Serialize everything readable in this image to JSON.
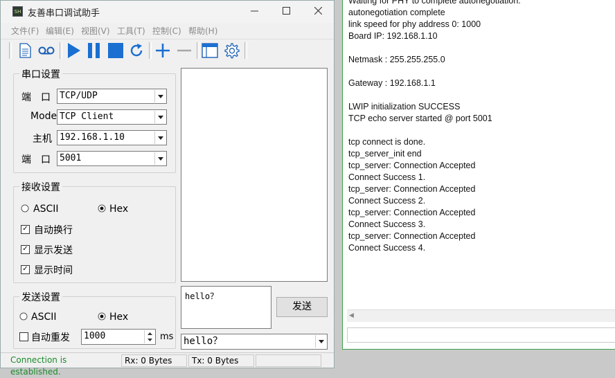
{
  "window": {
    "title": "友善串口调试助手",
    "app_icon_text": "SH",
    "minimize_icon": "minimize-icon",
    "maximize_icon": "maximize-icon",
    "close_icon": "close-icon"
  },
  "menu": [
    "文件(F)",
    "编辑(E)",
    "视图(V)",
    "工具(T)",
    "控制(C)",
    "帮助(H)"
  ],
  "toolbar": {
    "icons": [
      "document-icon",
      "cassette-icon",
      "play-icon",
      "pause-icon",
      "stop-icon",
      "refresh-icon",
      "plus-icon",
      "minus-icon",
      "window-icon",
      "gear-icon"
    ],
    "accent_color": "#1a6fd1"
  },
  "serial": {
    "title": "串口设置",
    "port_label": "端　口",
    "port_value": "TCP/UDP",
    "mode_label": "Mode",
    "mode_value": "TCP Client",
    "host_label": "主机",
    "host_value": "192.168.1.10",
    "port2_label": "端　口",
    "port2_value": "5001"
  },
  "receive": {
    "title": "接收设置",
    "ascii": "ASCII",
    "hex": "Hex",
    "selected": "Hex",
    "auto_newline": "自动换行",
    "show_send": "显示发送",
    "show_time": "显示时间",
    "auto_newline_checked": true,
    "show_send_checked": true,
    "show_time_checked": true
  },
  "send": {
    "title": "发送设置",
    "ascii": "ASCII",
    "hex": "Hex",
    "selected": "Hex",
    "auto_repeat": "自动重发",
    "auto_repeat_checked": false,
    "interval": "1000",
    "unit": "ms",
    "text": "hello？",
    "button": "发送",
    "history_value": "hello？"
  },
  "status": {
    "connection": "Connection is established.",
    "connection_color": "#1a8a2a",
    "rx": "Rx: 0 Bytes",
    "tx": "Tx: 0 Bytes"
  },
  "console": {
    "lines": [
      "Waiting for PHY to complete autonegotiation.",
      "autonegotiation complete",
      "link speed for phy address 0: 1000",
      "Board IP: 192.168.1.10",
      "",
      "Netmask : 255.255.255.0",
      "",
      "Gateway : 192.168.1.1",
      "",
      "LWIP initialization SUCCESS",
      "TCP echo server started @ port 5001",
      "",
      "tcp connect is done.",
      "tcp_server_init end",
      "tcp_server: Connection Accepted",
      "Connect Success 1.",
      "tcp_server: Connection Accepted",
      "Connect Success 2.",
      "tcp_server: Connection Accepted",
      "Connect Success 3.",
      "tcp_server: Connection Accepted",
      "Connect Success 4."
    ]
  }
}
